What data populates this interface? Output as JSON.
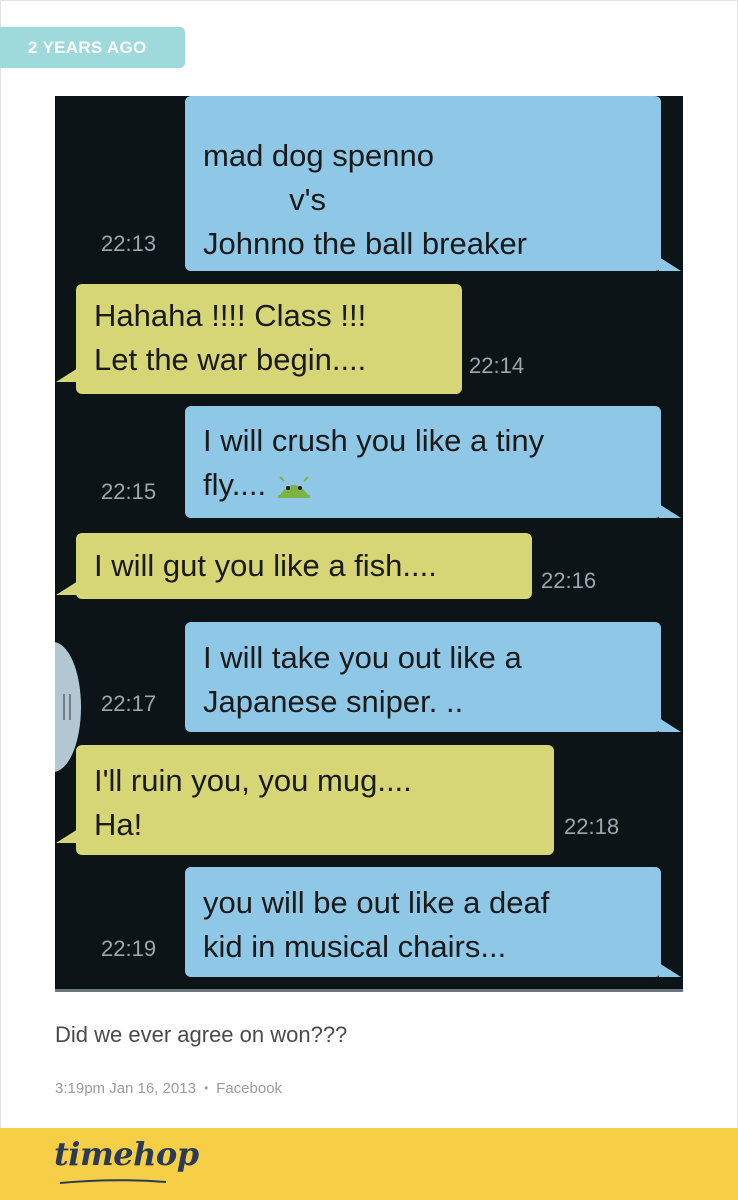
{
  "badge": {
    "label": "2 YEARS AGO"
  },
  "conversation": {
    "messages": [
      {
        "side": "out",
        "lines": [
          "mad dog spenno",
          "          v's",
          "Johnno the ball breaker"
        ],
        "time": "22:13"
      },
      {
        "side": "in",
        "lines": [
          "Hahaha !!!! Class !!!",
          "Let the war begin...."
        ],
        "time": "22:14"
      },
      {
        "side": "out",
        "lines": [
          "I will crush you like a tiny",
          "fly...."
        ],
        "time": "22:15"
      },
      {
        "side": "in",
        "lines": [
          "I will gut you like a fish...."
        ],
        "time": "22:16"
      },
      {
        "side": "out",
        "lines": [
          "I will take you out like a",
          "Japanese sniper. .."
        ],
        "time": "22:17"
      },
      {
        "side": "in",
        "lines": [
          "I'll ruin you, you mug....",
          "Ha!"
        ],
        "time": "22:18"
      },
      {
        "side": "out",
        "lines": [
          "you will be out like a deaf",
          "kid in musical chairs..."
        ],
        "time": "22:19"
      }
    ],
    "emoji_icon": "android-emoji-icon"
  },
  "post": {
    "caption": "Did we ever agree on won???",
    "time": "3:19pm Jan 16, 2013",
    "separator": "•",
    "source": "Facebook"
  },
  "footer": {
    "logo": "timehop"
  },
  "colors": {
    "badge": "#9ed9dc",
    "outgoing": "#8fc8e6",
    "incoming": "#d6d677",
    "footer": "#f7cf47",
    "logo": "#2b3a55"
  }
}
